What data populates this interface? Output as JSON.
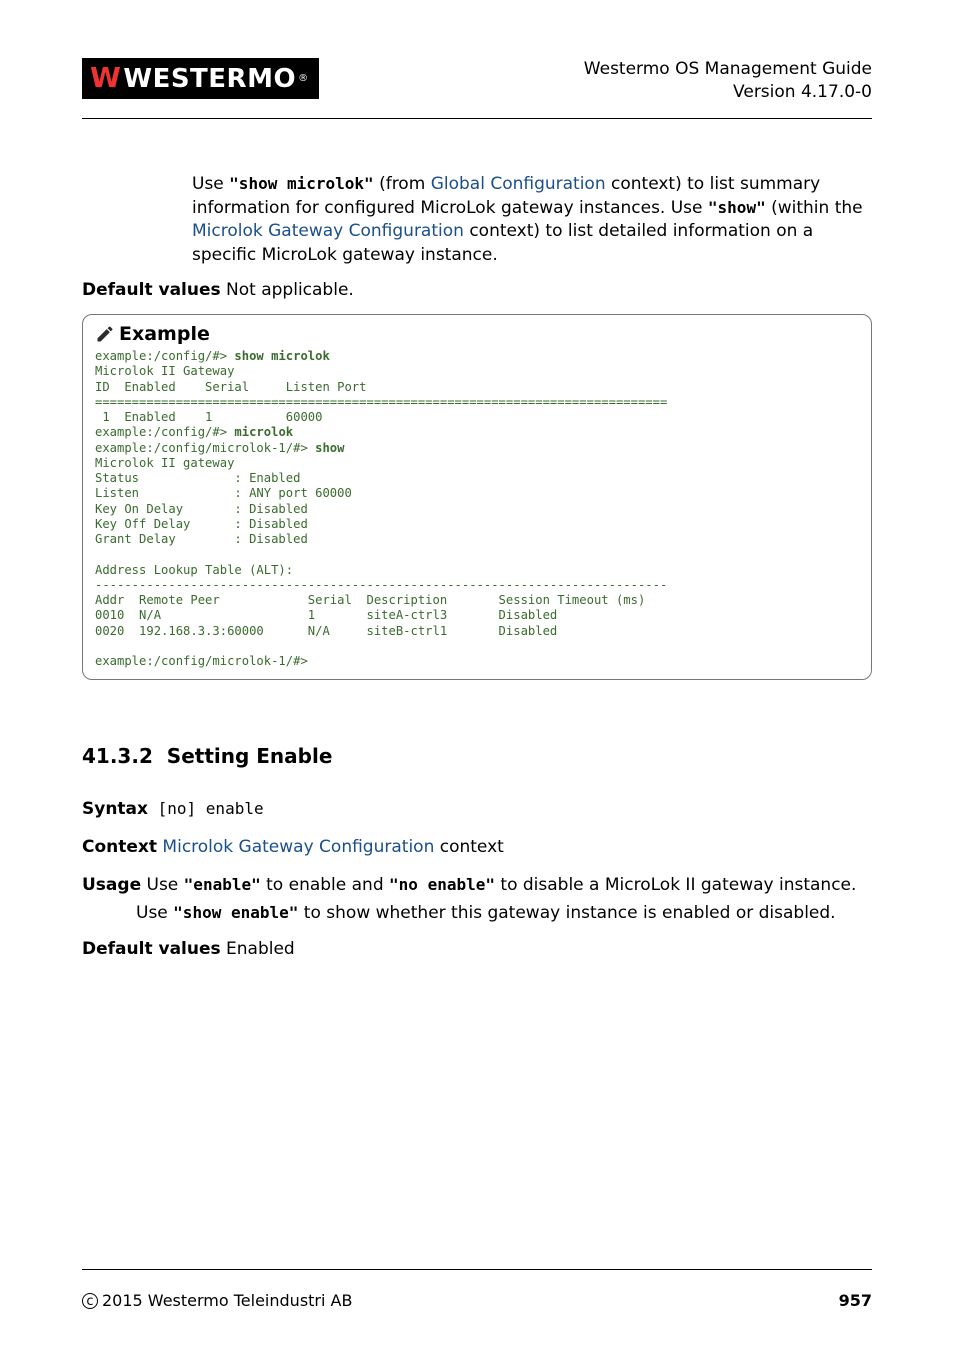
{
  "header": {
    "logo_text": "WESTERMO",
    "title_line1": "Westermo OS Management Guide",
    "title_line2": "Version 4.17.0-0"
  },
  "intro": {
    "p1_a": "Use ",
    "p1_cmd1": "\"show microlok\"",
    "p1_b": " (from ",
    "p1_link1": "Global Configuration",
    "p1_c": " context) to list summary information for configured MicroLok gateway instances. Use ",
    "p1_cmd2": "\"show\"",
    "p1_d": " (within the ",
    "p1_link2": "Microlok Gateway Configuration",
    "p1_e": " context) to list detailed information on a specific MicroLok gateway instance."
  },
  "default1": {
    "label": "Default values",
    "value": " Not applicable."
  },
  "example": {
    "title": "Example",
    "lines": {
      "l01a": "example:/config/#> ",
      "l01b": "show microlok",
      "l02": "Microlok II Gateway",
      "l03": "ID  Enabled    Serial     Listen Port",
      "l04": "==============================================================================",
      "l05": " 1  Enabled    1          60000",
      "l06a": "example:/config/#> ",
      "l06b": "microlok",
      "l07a": "example:/config/microlok-1/#> ",
      "l07b": "show",
      "l08": "Microlok II gateway",
      "l09": "Status             : Enabled",
      "l10": "Listen             : ANY port 60000",
      "l11": "Key On Delay       : Disabled",
      "l12": "Key Off Delay      : Disabled",
      "l13": "Grant Delay        : Disabled",
      "l14": "",
      "l15": "Address Lookup Table (ALT):",
      "l16": "------------------------------------------------------------------------------",
      "l17": "Addr  Remote Peer            Serial  Description       Session Timeout (ms)",
      "l18": "0010  N/A                    1       siteA-ctrl3       Disabled",
      "l19": "0020  192.168.3.3:60000      N/A     siteB-ctrl1       Disabled",
      "l20": "",
      "l21": "example:/config/microlok-1/#>"
    }
  },
  "section": {
    "number": "41.3.2",
    "title": "Setting Enable"
  },
  "syntax": {
    "label": "Syntax",
    "value": " [no] enable"
  },
  "context": {
    "label": "Context",
    "link": "Microlok Gateway Configuration",
    "after": " context"
  },
  "usage": {
    "label": "Usage",
    "p1_a": " Use ",
    "p1_cmd1": "\"enable\"",
    "p1_b": " to enable and ",
    "p1_cmd2": "\"no enable\"",
    "p1_c": " to disable a MicroLok II gateway instance.",
    "p2_a": "Use ",
    "p2_cmd1": "\"show enable\"",
    "p2_b": " to show whether this gateway instance is enabled or disabled."
  },
  "default2": {
    "label": "Default values",
    "value": " Enabled"
  },
  "footer": {
    "copyright": "2015 Westermo Teleindustri AB",
    "page": "957"
  }
}
